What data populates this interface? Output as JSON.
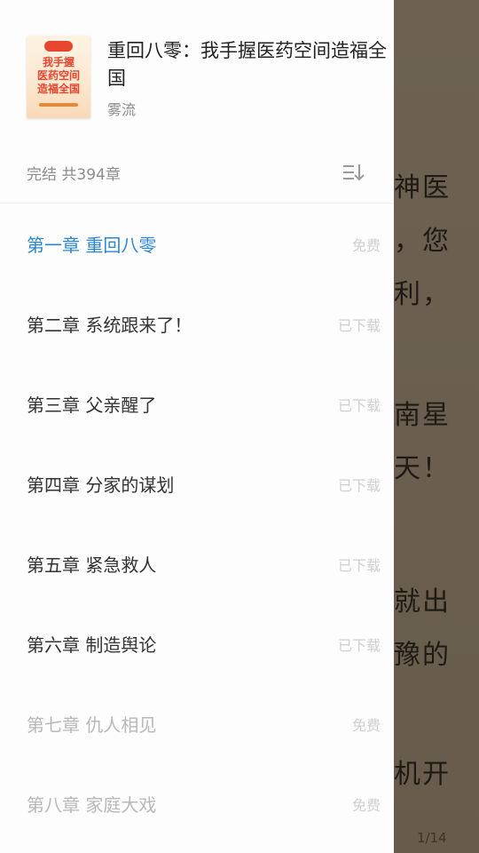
{
  "book": {
    "title": "重回八零：我手握医药空间造福全国",
    "author": "雾流",
    "status": "完结 共394章",
    "cover_text": {
      "tag": "重回八零",
      "line1": "我手握",
      "line2": "医药空间",
      "line3": "造福全国"
    }
  },
  "colors": {
    "accent": "#2b86d6",
    "drawer_bg": "#fdfdfd",
    "reader_bg": "#6b6050"
  },
  "chapters": [
    {
      "title": "第一章 重回八零",
      "status": "免费",
      "state": "current"
    },
    {
      "title": "第二章 系统跟来了！",
      "status": "已下载",
      "state": "downloaded"
    },
    {
      "title": "第三章 父亲醒了",
      "status": "已下载",
      "state": "downloaded"
    },
    {
      "title": "第四章 分家的谋划",
      "status": "已下载",
      "state": "downloaded"
    },
    {
      "title": "第五章 紧急救人",
      "status": "已下载",
      "state": "downloaded"
    },
    {
      "title": "第六章 制造舆论",
      "status": "已下载",
      "state": "downloaded"
    },
    {
      "title": "第七章 仇人相见",
      "status": "免费",
      "state": "not-downloaded"
    },
    {
      "title": "第八章 家庭大戏",
      "status": "免费",
      "state": "not-downloaded"
    }
  ],
  "reader": {
    "lines": [
      "神医",
      "，您",
      "利，",
      "南星",
      "天！",
      "就出",
      "豫的",
      "机开"
    ],
    "page_indicator": "1/14"
  },
  "icons": {
    "sort": "sort-order-icon"
  }
}
